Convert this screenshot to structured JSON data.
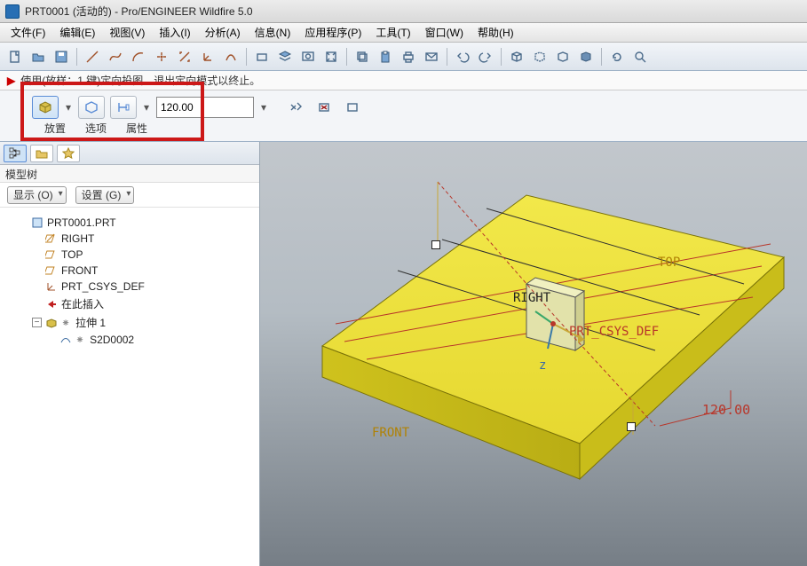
{
  "title": "PRT0001 (活动的) - Pro/ENGINEER Wildfire 5.0",
  "menu": {
    "file": "文件(F)",
    "edit": "编辑(E)",
    "view": "视图(V)",
    "insert": "插入(I)",
    "analysis": "分析(A)",
    "info": "信息(N)",
    "app": "应用程序(P)",
    "tools": "工具(T)",
    "window": "窗口(W)",
    "help": "帮助(H)"
  },
  "hint_text": "使用(放样：1 键)定向投图。退出定向模式以终止。",
  "dashboard": {
    "depth_value": "120.00",
    "tab_place": "放置",
    "tab_option": "选项",
    "tab_attr": "属性"
  },
  "sidebar": {
    "head": "模型树",
    "show_label": "显示 (O)",
    "settings_label": "设置 (G)"
  },
  "tree": {
    "root": "PRT0001.PRT",
    "right": "RIGHT",
    "top": "TOP",
    "front": "FRONT",
    "csys": "PRT_CSYS_DEF",
    "insert_here": "在此插入",
    "extrude": "拉伸 1",
    "sketch": "S2D0002"
  },
  "viewport": {
    "label_top": "TOP",
    "label_front": "FRONT",
    "label_right": "RIGHT",
    "label_csys": "PRT_CSYS_DEF",
    "axis_z": "z",
    "dim_value": "120.00"
  }
}
